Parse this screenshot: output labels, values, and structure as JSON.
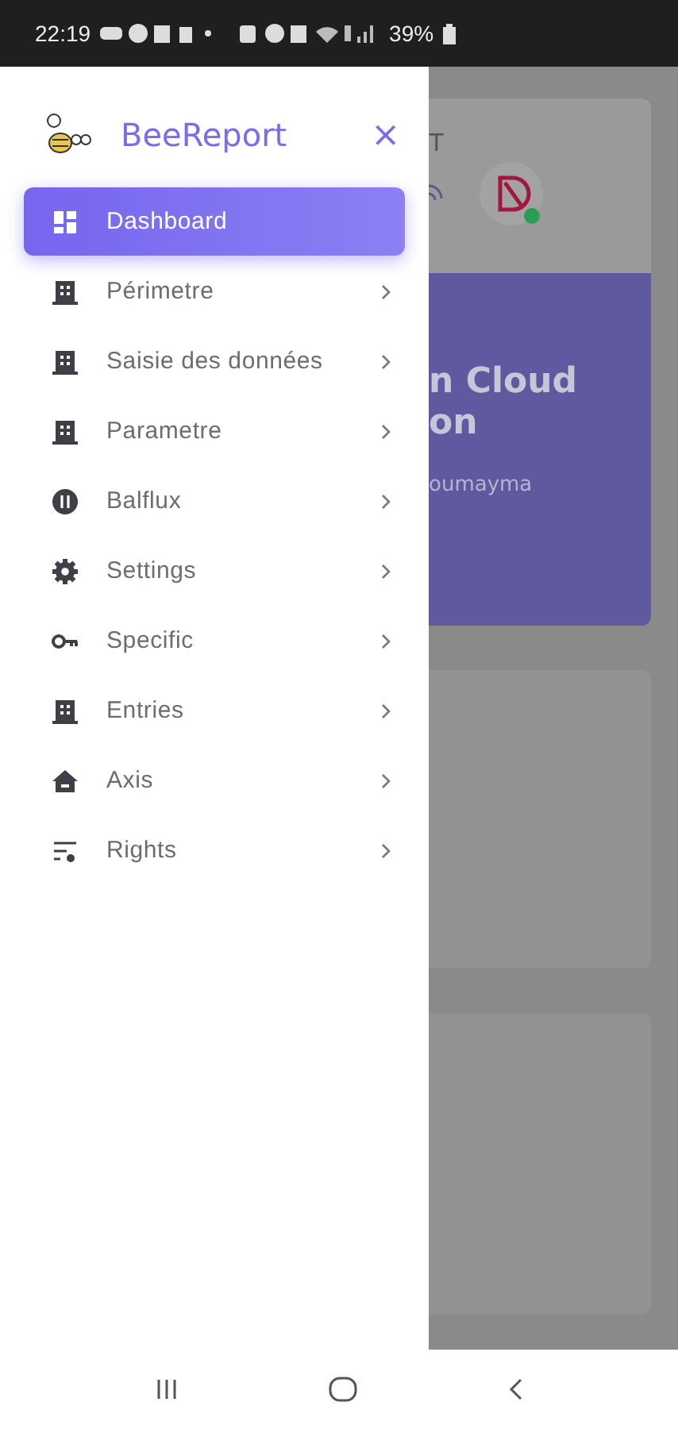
{
  "status_bar": {
    "time": "22:19",
    "battery": "39%"
  },
  "drawer": {
    "brand": "BeeReport",
    "close": "×",
    "items": [
      {
        "label": "Dashboard",
        "kind": "grid",
        "selected": true,
        "submenu": false
      },
      {
        "label": "Périmetre",
        "kind": "building",
        "selected": false,
        "submenu": true
      },
      {
        "label": "Saisie des données",
        "kind": "building",
        "selected": false,
        "submenu": true
      },
      {
        "label": "Parametre",
        "kind": "building",
        "selected": false,
        "submenu": true
      },
      {
        "label": "Balflux",
        "kind": "balance",
        "selected": false,
        "submenu": true
      },
      {
        "label": "Settings",
        "kind": "gear",
        "selected": false,
        "submenu": true
      },
      {
        "label": "Specific",
        "kind": "key",
        "selected": false,
        "submenu": true
      },
      {
        "label": "Entries",
        "kind": "building",
        "selected": false,
        "submenu": true
      },
      {
        "label": "Axis",
        "kind": "home",
        "selected": false,
        "submenu": true
      },
      {
        "label": "Rights",
        "kind": "rights",
        "selected": false,
        "submenu": true
      }
    ]
  },
  "background": {
    "header_fragment": "T",
    "banner_title": [
      "n Cloud",
      "on"
    ],
    "banner_user": "oumayma"
  }
}
